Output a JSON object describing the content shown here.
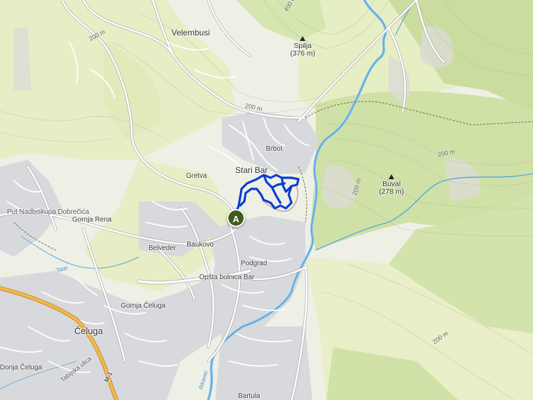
{
  "map": {
    "place_labels": {
      "velembusi": "Velembusi",
      "spilja_name": "Spilja",
      "spilja_elev": "(376 m)",
      "buval_name": "Buval",
      "buval_elev": "(278 m)",
      "brbot": "Brbot",
      "stari_bar": "Stari Bar",
      "gretva": "Gretva",
      "put_nadbiskupa": "Put Nadbiskupa Dobrečića",
      "gornja_rena": "Gornja Rena",
      "belveder": "Belveder",
      "baukovo": "Baukovo",
      "podgrad": "Podgrad",
      "opsta_bolnica": "Opšta bolnica Bar",
      "gornja_celuga": "Gornja Čeluga",
      "celuga": "Čeluga",
      "donja_celuga": "Donja Čeluga",
      "tabijska": "Tabijska ulica",
      "rikavac": "Rikavac",
      "bartula": "Bartula",
      "tatin": "Tatin",
      "m1": "M-1"
    },
    "contour_labels": {
      "c1": "200 m",
      "c2": "200 m",
      "c3": "200 m",
      "c4": "200 m",
      "c5": "200 m",
      "c6": "400 m"
    },
    "start_marker": "A",
    "colors": {
      "route": "#0a3ecf",
      "river": "#58a8dc",
      "urban": "#d8d9dd",
      "forest": "#cfe1a6",
      "vegetation": "#e9eec7",
      "primary_road": "#f0b94c",
      "marker": "#3f5c1c"
    }
  }
}
